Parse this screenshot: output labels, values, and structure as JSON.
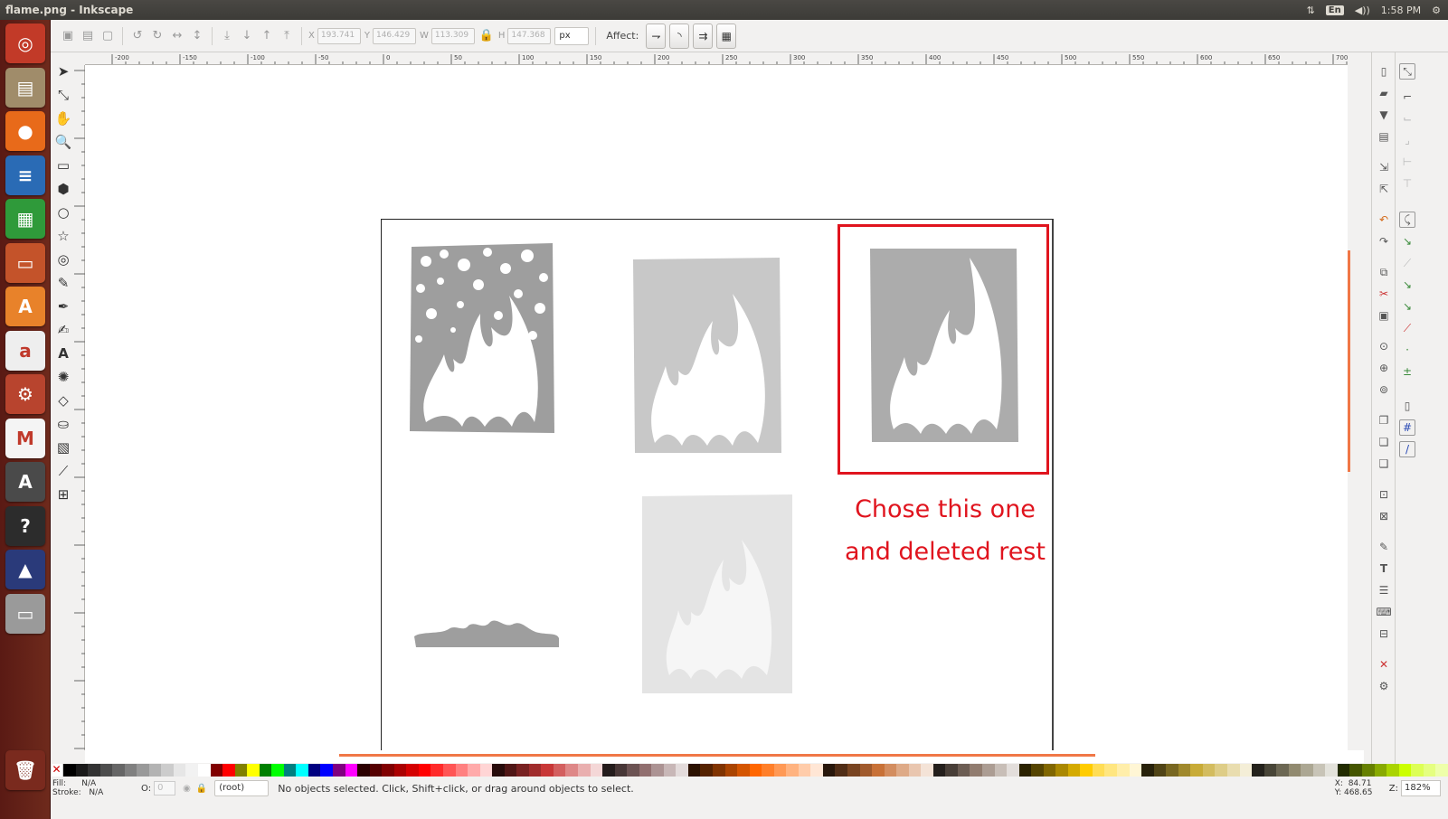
{
  "window": {
    "title": "flame.png - Inkscape",
    "time": "1:58 PM",
    "lang": "En"
  },
  "launcher": [
    {
      "name": "dash-icon",
      "glyph": "◎",
      "bg": "#c23a28"
    },
    {
      "name": "files-icon",
      "glyph": "▤",
      "bg": "#a08c6a"
    },
    {
      "name": "firefox-icon",
      "glyph": "●",
      "bg": "#e86a1a"
    },
    {
      "name": "writer-icon",
      "glyph": "≡",
      "bg": "#2a6bb5"
    },
    {
      "name": "calc-icon",
      "glyph": "▦",
      "bg": "#2f9a3a"
    },
    {
      "name": "impress-icon",
      "glyph": "▭",
      "bg": "#c4532a"
    },
    {
      "name": "software-center-icon",
      "glyph": "A",
      "bg": "#e8822a"
    },
    {
      "name": "amazon-icon",
      "glyph": "a",
      "bg": "#eeeeee"
    },
    {
      "name": "system-settings-icon",
      "glyph": "⚙",
      "bg": "#b8442e"
    },
    {
      "name": "gmail-icon",
      "glyph": "M",
      "bg": "#f4f4f4"
    },
    {
      "name": "updater-icon",
      "glyph": "A",
      "bg": "#4a4a4a"
    },
    {
      "name": "terminal-icon",
      "glyph": "?",
      "bg": "#2c2c2c"
    },
    {
      "name": "inkscape-icon",
      "glyph": "▲",
      "bg": "#2a3a7a"
    },
    {
      "name": "drive-icon",
      "glyph": "▭",
      "bg": "#9a9a9a"
    },
    {
      "name": "trash-icon",
      "glyph": "🗑",
      "bg": "#7a2a1e"
    }
  ],
  "toolbar": {
    "x_label": "X",
    "x_value": "193.741",
    "y_label": "Y",
    "y_value": "146.429",
    "w_label": "W",
    "w_value": "113.309",
    "h_label": "H",
    "h_value": "147.368",
    "unit": "px",
    "affect_label": "Affect:"
  },
  "ruler": {
    "ticks": [
      "-200",
      "-150",
      "-100",
      "-50",
      "0",
      "50",
      "100",
      "150",
      "200",
      "250",
      "300",
      "350",
      "400",
      "450",
      "500",
      "550",
      "600",
      "650",
      "700"
    ]
  },
  "annotation": {
    "line1": "Chose this one",
    "line2": "and deleted rest",
    "color": "#e0141e"
  },
  "status": {
    "fill_label": "Fill:",
    "fill_value": "N/A",
    "stroke_label": "Stroke:",
    "stroke_value": "N/A",
    "opacity_label": "O:",
    "opacity_value": "0",
    "layer": "(root)",
    "message": "No objects selected. Click, Shift+click, or drag around objects to select.",
    "x_label": "X:",
    "x_coord": "84.71",
    "y_label": "Y:",
    "y_coord": "468.65",
    "zoom_label": "Z:",
    "zoom": "182%"
  },
  "palette": [
    "#000000",
    "#1a1a1a",
    "#333333",
    "#4d4d4d",
    "#666666",
    "#808080",
    "#999999",
    "#b3b3b3",
    "#cccccc",
    "#e6e6e6",
    "#f2f2f2",
    "#ffffff",
    "#800000",
    "#ff0000",
    "#808000",
    "#ffff00",
    "#008000",
    "#00ff00",
    "#008080",
    "#00ffff",
    "#000080",
    "#0000ff",
    "#800080",
    "#ff00ff",
    "#2b0000",
    "#550000",
    "#800000",
    "#aa0000",
    "#d40000",
    "#ff0000",
    "#ff2a2a",
    "#ff5555",
    "#ff8080",
    "#ffaaaa",
    "#ffd5d5",
    "#280b0b",
    "#501616",
    "#782121",
    "#a02c2c",
    "#c83737",
    "#d35f5f",
    "#de8787",
    "#e9afaf",
    "#f4d7d7",
    "#241c1c",
    "#483737",
    "#6c5353",
    "#916f6f",
    "#ac9393",
    "#c8b7b7",
    "#e3dbdb",
    "#2b1100",
    "#552200",
    "#803300",
    "#aa4400",
    "#d45500",
    "#ff6600",
    "#ff7f2a",
    "#ff9955",
    "#ffb380",
    "#ffccaa",
    "#ffe6d5",
    "#28170b",
    "#502d16",
    "#784421",
    "#a05a2c",
    "#c87137",
    "#d38d5f",
    "#deaa87",
    "#e9c6af",
    "#f4e3d7",
    "#241f1c",
    "#483e37",
    "#6c5d53",
    "#917c6f",
    "#ac9d93",
    "#c8beb7",
    "#e3dedb",
    "#2b2200",
    "#554400",
    "#806600",
    "#aa8800",
    "#d4aa00",
    "#ffcc00",
    "#ffdd55",
    "#ffe680",
    "#ffeeaa",
    "#fff6d5",
    "#28220b",
    "#504416",
    "#786721",
    "#a0892c",
    "#c8ab37",
    "#d3bc5f",
    "#decd87",
    "#e9ddaf",
    "#f4eed7",
    "#24221c",
    "#484537",
    "#6c6753",
    "#918a6f",
    "#aca793",
    "#c8c4b7",
    "#e3e2db",
    "#222b00",
    "#445500",
    "#668000",
    "#88aa00",
    "#aad400",
    "#ccff00",
    "#ddff55",
    "#e5ff80",
    "#eeffaa"
  ]
}
